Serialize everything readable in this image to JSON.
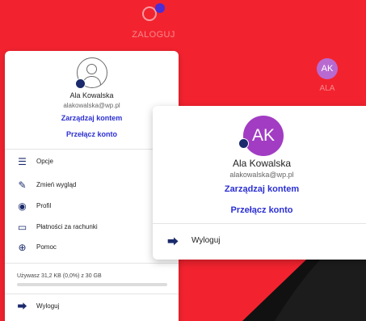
{
  "colors": {
    "accent": "#2b2fd3",
    "background": "#f2232f",
    "avatar_purple": "#a23cc3"
  },
  "top": {
    "login_label": "ZALOGUJ",
    "ak_label": "ALA",
    "ak_initials": "AK"
  },
  "account": {
    "name": "Ala Kowalska",
    "email": "alakowalska@wp.pl",
    "initials": "AK",
    "manage_label": "Zarządzaj kontem",
    "switch_label": "Przełącz konto"
  },
  "menu": {
    "items": [
      {
        "label": "Opcje",
        "icon": "sliders-icon"
      },
      {
        "label": "Zmień wygląd",
        "icon": "brush-icon"
      },
      {
        "label": "Profil",
        "icon": "profile-icon"
      },
      {
        "label": "Płatności za rachunki",
        "icon": "card-icon"
      },
      {
        "label": "Pomoc",
        "icon": "help-icon"
      }
    ],
    "logout_label": "Wyloguj"
  },
  "storage": {
    "text": "Używasz 31,2 KB (0,0%) z 30 GB",
    "used_fraction": 0.0
  }
}
